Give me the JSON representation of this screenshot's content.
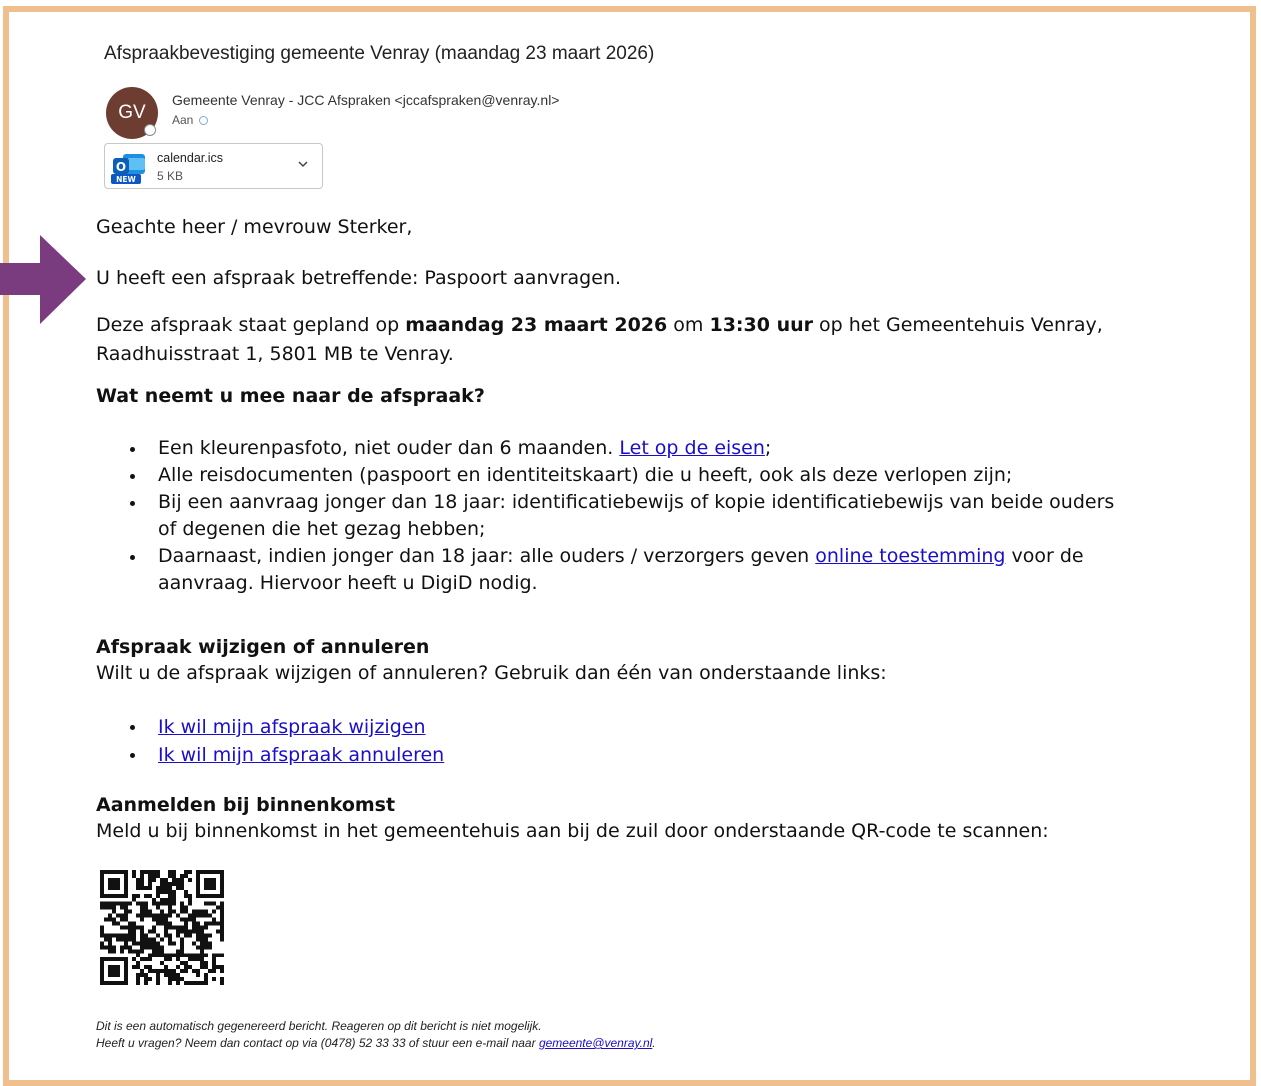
{
  "email": {
    "subject": "Afspraakbevestiging gemeente Venray (maandag 23 maart 2026)",
    "avatar_initials": "GV",
    "sender": "Gemeente Venray - JCC Afspraken <jccafspraken@venray.nl>",
    "to_label": "Aan",
    "attachment": {
      "name": "calendar.ics",
      "size": "5 KB",
      "icon": "outlook-new-icon"
    }
  },
  "body": {
    "greeting": "Geachte heer / mevrouw Sterker,",
    "topic": "U heeft een afspraak betreffende: Paspoort aanvragen.",
    "planned_prefix": "Deze afspraak staat gepland op ",
    "planned_date": "maandag 23 maart 2026",
    "planned_mid": " om ",
    "planned_time": "13:30 uur",
    "planned_suffix": " op het Gemeentehuis Venray,",
    "planned_address": "Raadhuisstraat 1, 5801 MB te Venray.",
    "wat_heading": "Wat neemt u mee naar de afspraak?",
    "bullet1_text": "Een kleurenpasfoto, niet ouder dan 6 maanden. ",
    "bullet1_link": "Let op de eisen",
    "bullet1_end": ";",
    "bullet2_text": "Alle reisdocumenten (paspoort en identiteitskaart) die u heeft, ook als deze verlopen zijn;",
    "bullet3_line1": "Bij een aanvraag jonger dan 18 jaar: identificatiebewijs of kopie identificatiebewijs van beide ouders",
    "bullet3_line2": "of degenen die het gezag hebben;",
    "bullet4_text": "Daarnaast, indien jonger dan 18 jaar: alle ouders / verzorgers geven ",
    "bullet4_link": "online toestemming",
    "bullet4_end": " voor de",
    "bullet4_line2": "aanvraag. Hiervoor heeft u DigiD nodig.",
    "wijzigen_heading": "Afspraak wijzigen of annuleren",
    "wijzigen_text": "Wilt u de afspraak wijzigen of annuleren? Gebruik dan één van onderstaande links:",
    "link_wijzigen": "Ik wil mijn afspraak wijzigen",
    "link_annuleren": "Ik wil mijn afspraak annuleren",
    "aanmelden_heading": "Aanmelden bij binnenkomst",
    "aanmelden_text": "Meld u bij binnenkomst in het gemeentehuis aan bij de zuil door onderstaande QR-code te scannen:",
    "footer_line1": "Dit is een automatisch gegenereerd bericht. Reageren op dit bericht is niet mogelijk.",
    "footer_line2_prefix": "Heeft u vragen? Neem dan contact op via (0478) 52 33 33 of stuur een e-mail naar ",
    "footer_email": "gemeente@venray.nl",
    "footer_line2_suffix": "."
  },
  "colors": {
    "frame": "#efc08e",
    "avatar": "#6d3d32",
    "arrow": "#7b3c7f",
    "link": "#1a0dcc"
  }
}
